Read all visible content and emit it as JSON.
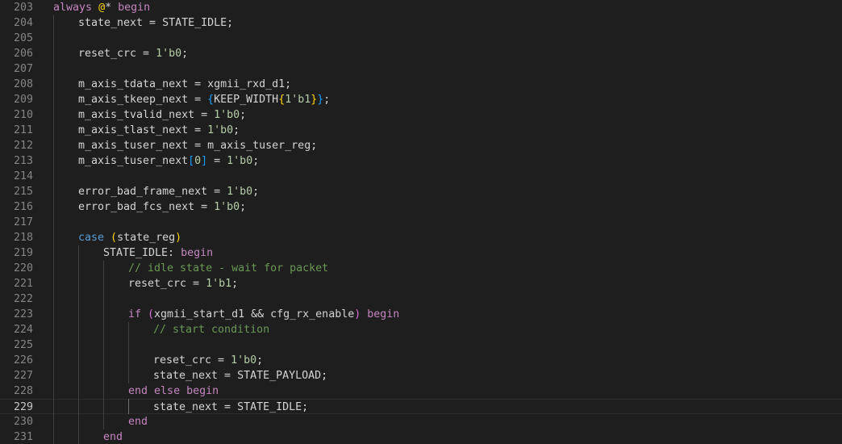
{
  "editor": {
    "language": "verilog",
    "current_line": "229",
    "colors": {
      "background": "#1e1e1e",
      "text": "#d4d4d4",
      "line_number": "#858585",
      "keyword": "#c586c0",
      "keyword_blue": "#569cd6",
      "number": "#b5cea8",
      "comment": "#6a9955",
      "bracket_1": "#ffd700",
      "bracket_2": "#da70d6",
      "bracket_3": "#179fff"
    },
    "lines": [
      {
        "n": "203",
        "indent": 0,
        "tokens": [
          [
            "kw",
            "always"
          ],
          [
            "",
            " "
          ],
          [
            "p1",
            "@"
          ],
          [
            "",
            "* "
          ],
          [
            "kw",
            "begin"
          ]
        ]
      },
      {
        "n": "204",
        "indent": 1,
        "tokens": [
          [
            "",
            "state_next = STATE_IDLE;"
          ]
        ]
      },
      {
        "n": "205",
        "indent": 0,
        "tokens": []
      },
      {
        "n": "206",
        "indent": 1,
        "tokens": [
          [
            "",
            "reset_crc = "
          ],
          [
            "num",
            "1'b0"
          ],
          [
            "",
            ";"
          ]
        ]
      },
      {
        "n": "207",
        "indent": 0,
        "tokens": []
      },
      {
        "n": "208",
        "indent": 1,
        "tokens": [
          [
            "",
            "m_axis_tdata_next = xgmii_rxd_d1;"
          ]
        ]
      },
      {
        "n": "209",
        "indent": 1,
        "tokens": [
          [
            "",
            "m_axis_tkeep_next = "
          ],
          [
            "p3",
            "{"
          ],
          [
            "",
            "KEEP_WIDTH"
          ],
          [
            "p1",
            "{"
          ],
          [
            "num",
            "1'b1"
          ],
          [
            "p1",
            "}"
          ],
          [
            "p3",
            "}"
          ],
          [
            "",
            ";"
          ]
        ]
      },
      {
        "n": "210",
        "indent": 1,
        "tokens": [
          [
            "",
            "m_axis_tvalid_next = "
          ],
          [
            "num",
            "1'b0"
          ],
          [
            "",
            ";"
          ]
        ]
      },
      {
        "n": "211",
        "indent": 1,
        "tokens": [
          [
            "",
            "m_axis_tlast_next = "
          ],
          [
            "num",
            "1'b0"
          ],
          [
            "",
            ";"
          ]
        ]
      },
      {
        "n": "212",
        "indent": 1,
        "tokens": [
          [
            "",
            "m_axis_tuser_next = m_axis_tuser_reg;"
          ]
        ]
      },
      {
        "n": "213",
        "indent": 1,
        "tokens": [
          [
            "",
            "m_axis_tuser_next"
          ],
          [
            "p3",
            "["
          ],
          [
            "num",
            "0"
          ],
          [
            "p3",
            "]"
          ],
          [
            "",
            " = "
          ],
          [
            "num",
            "1'b0"
          ],
          [
            "",
            ";"
          ]
        ]
      },
      {
        "n": "214",
        "indent": 0,
        "tokens": []
      },
      {
        "n": "215",
        "indent": 1,
        "tokens": [
          [
            "",
            "error_bad_frame_next = "
          ],
          [
            "num",
            "1'b0"
          ],
          [
            "",
            ";"
          ]
        ]
      },
      {
        "n": "216",
        "indent": 1,
        "tokens": [
          [
            "",
            "error_bad_fcs_next = "
          ],
          [
            "num",
            "1'b0"
          ],
          [
            "",
            ";"
          ]
        ]
      },
      {
        "n": "217",
        "indent": 0,
        "tokens": []
      },
      {
        "n": "218",
        "indent": 1,
        "tokens": [
          [
            "kw2",
            "case"
          ],
          [
            "",
            " "
          ],
          [
            "p1",
            "("
          ],
          [
            "",
            "state_reg"
          ],
          [
            "p1",
            ")"
          ]
        ]
      },
      {
        "n": "219",
        "indent": 2,
        "tokens": [
          [
            "",
            "STATE_IDLE: "
          ],
          [
            "kw",
            "begin"
          ]
        ]
      },
      {
        "n": "220",
        "indent": 3,
        "tokens": [
          [
            "cmt",
            "// idle state - wait for packet"
          ]
        ]
      },
      {
        "n": "221",
        "indent": 3,
        "tokens": [
          [
            "",
            "reset_crc = "
          ],
          [
            "num",
            "1'b1"
          ],
          [
            "",
            ";"
          ]
        ]
      },
      {
        "n": "222",
        "indent": 0,
        "tokens": []
      },
      {
        "n": "223",
        "indent": 3,
        "tokens": [
          [
            "kw",
            "if"
          ],
          [
            "",
            " "
          ],
          [
            "p2",
            "("
          ],
          [
            "",
            "xgmii_start_d1 && cfg_rx_enable"
          ],
          [
            "p2",
            ")"
          ],
          [
            "",
            " "
          ],
          [
            "kw",
            "begin"
          ]
        ]
      },
      {
        "n": "224",
        "indent": 4,
        "tokens": [
          [
            "cmt",
            "// start condition"
          ]
        ]
      },
      {
        "n": "225",
        "indent": 0,
        "tokens": []
      },
      {
        "n": "226",
        "indent": 4,
        "tokens": [
          [
            "",
            "reset_crc = "
          ],
          [
            "num",
            "1'b0"
          ],
          [
            "",
            ";"
          ]
        ]
      },
      {
        "n": "227",
        "indent": 4,
        "tokens": [
          [
            "",
            "state_next = STATE_PAYLOAD;"
          ]
        ]
      },
      {
        "n": "228",
        "indent": 3,
        "tokens": [
          [
            "kw",
            "end"
          ],
          [
            "",
            " "
          ],
          [
            "kw",
            "else"
          ],
          [
            "",
            " "
          ],
          [
            "kw",
            "begin"
          ]
        ]
      },
      {
        "n": "229",
        "indent": 4,
        "tokens": [
          [
            "",
            "state_next = STATE_IDLE;"
          ]
        ]
      },
      {
        "n": "230",
        "indent": 3,
        "tokens": [
          [
            "kw",
            "end"
          ]
        ]
      },
      {
        "n": "231",
        "indent": 2,
        "tokens": [
          [
            "kw",
            "end"
          ]
        ]
      }
    ]
  }
}
